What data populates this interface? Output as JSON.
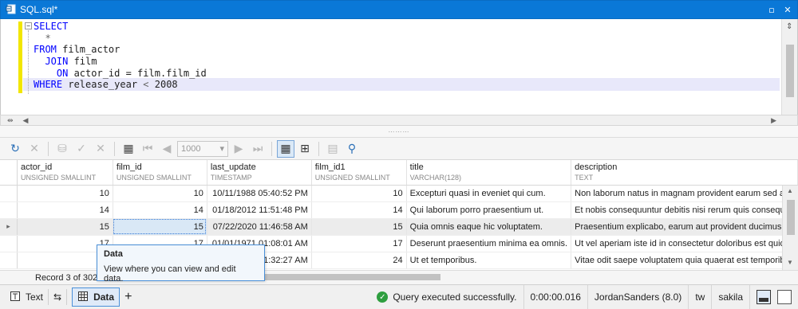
{
  "window": {
    "title": "SQL.sql*"
  },
  "editor": {
    "lines": [
      {
        "parts": [
          {
            "t": "SELECT",
            "k": "kw"
          }
        ]
      },
      {
        "parts": [
          {
            "t": "  *",
            "k": "op"
          }
        ]
      },
      {
        "parts": [
          {
            "t": "FROM",
            "k": "kw"
          },
          {
            "t": " film_actor",
            "k": ""
          }
        ]
      },
      {
        "parts": [
          {
            "t": "  JOIN",
            "k": "kw"
          },
          {
            "t": " film",
            "k": ""
          }
        ]
      },
      {
        "parts": [
          {
            "t": "    ON",
            "k": "kw"
          },
          {
            "t": " actor_id = film.film_id",
            "k": ""
          }
        ]
      },
      {
        "parts": [
          {
            "t": "WHERE",
            "k": "kw"
          },
          {
            "t": " release_year ",
            "k": ""
          },
          {
            "t": "<",
            "k": "op"
          },
          {
            "t": " 2008",
            "k": ""
          }
        ]
      }
    ]
  },
  "toolbar": {
    "page_size": "1000"
  },
  "grid": {
    "columns": [
      {
        "name": "actor_id",
        "type": "UNSIGNED SMALLINT"
      },
      {
        "name": "film_id",
        "type": "UNSIGNED SMALLINT"
      },
      {
        "name": "last_update",
        "type": "TIMESTAMP"
      },
      {
        "name": "film_id1",
        "type": "UNSIGNED SMALLINT"
      },
      {
        "name": "title",
        "type": "VARCHAR(128)"
      },
      {
        "name": "description",
        "type": "TEXT"
      }
    ],
    "rows": [
      [
        "10",
        "10",
        "10/11/1988 05:40:52 PM",
        "10",
        "Excepturi quasi in eveniet qui cum.",
        "Non laborum natus in magnam provident earum sed as"
      ],
      [
        "14",
        "14",
        "01/18/2012 11:51:48 PM",
        "14",
        "Qui laborum porro praesentium ut.",
        "Et nobis consequuntur debitis nisi rerum quis consequu"
      ],
      [
        "15",
        "15",
        "07/22/2020 11:46:58 AM",
        "15",
        "Quia omnis eaque hic voluptatem.",
        "Praesentium explicabo, earum aut provident ducimus a"
      ],
      [
        "17",
        "17",
        "01/01/1971 01:08:01 AM",
        "17",
        "Deserunt praesentium minima ea omnis.",
        "Ut vel aperiam iste id in consectetur doloribus est quide"
      ],
      [
        "",
        "",
        "01:32:27 AM",
        "24",
        "Ut et temporibus.",
        "Vitae odit saepe voluptatem quia quaerat est temporib"
      ]
    ],
    "current_row_marker": "▸"
  },
  "record_bar": {
    "text": "Record 3 of 302"
  },
  "tooltip": {
    "title": "Data",
    "text": "View where you can view and edit data."
  },
  "status": {
    "tab_text": "Text",
    "tab_data": "Data",
    "add": "+",
    "message": "Query executed successfully.",
    "duration": "0:00:00.016",
    "connection": "JordanSanders (8.0)",
    "server": "tw",
    "database": "sakila"
  }
}
